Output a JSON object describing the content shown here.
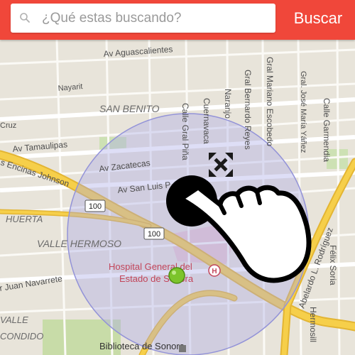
{
  "search": {
    "placeholder": "¿Qué estas buscando?",
    "button_label": "Buscar"
  },
  "map": {
    "streets": {
      "aguascalientes": "Av Aguascalientes",
      "nayarit": "Nayarit",
      "cruz": "Cruz",
      "tamaulipas": "Av Tamaulipas",
      "zacatecas": "Av Zacatecas",
      "san_luis": "Av San Luis P",
      "encinas_johnson": "s Encinas Johnson",
      "juan_navarrete": "r Juan Navarrete",
      "gral_pina": "Calle Gral Piña",
      "cuernavaca": "Cuernavaca",
      "naranjo": "Naranjo",
      "bernardo_reyes": "Gral Bernardo Reyes",
      "mariano_escobedo": "Gral Mariano Escobedo",
      "jose_maria_yanez": "Gral. José María Yáñez",
      "garmendia": "Calle Garmendia",
      "abelardo_rodriguez": "Abelardo L. Rodríguez",
      "felix_soria": "Félix Soria",
      "hermosillo": "Hermosill"
    },
    "neighborhoods": {
      "san_benito": "SAN BENITO",
      "huerta": "HUERTA",
      "valle_hermoso": "VALLE HERMOSO",
      "valle": "VALLE",
      "condido": "CONDIDO"
    },
    "places": {
      "hospital_line1": "Hospital General del",
      "hospital_line2": "Estado de Sonora",
      "hospital_marker": "H",
      "biblioteca": "Biblioteca de Sonora"
    },
    "route_shields": [
      "100",
      "100"
    ]
  },
  "colors": {
    "topbar": "#f0473a",
    "map_background": "#e8e4da",
    "highway": "#f6cf4a",
    "radius_fill": "#a9a9e8",
    "location_pin": "#7cc42b",
    "place_text": "#c2455a"
  },
  "icons": {
    "search": "search-icon",
    "move": "move-arrows-icon",
    "gesture": "hand-tap-gesture-icon",
    "hospital": "hospital-icon",
    "location": "location-pin-icon"
  }
}
